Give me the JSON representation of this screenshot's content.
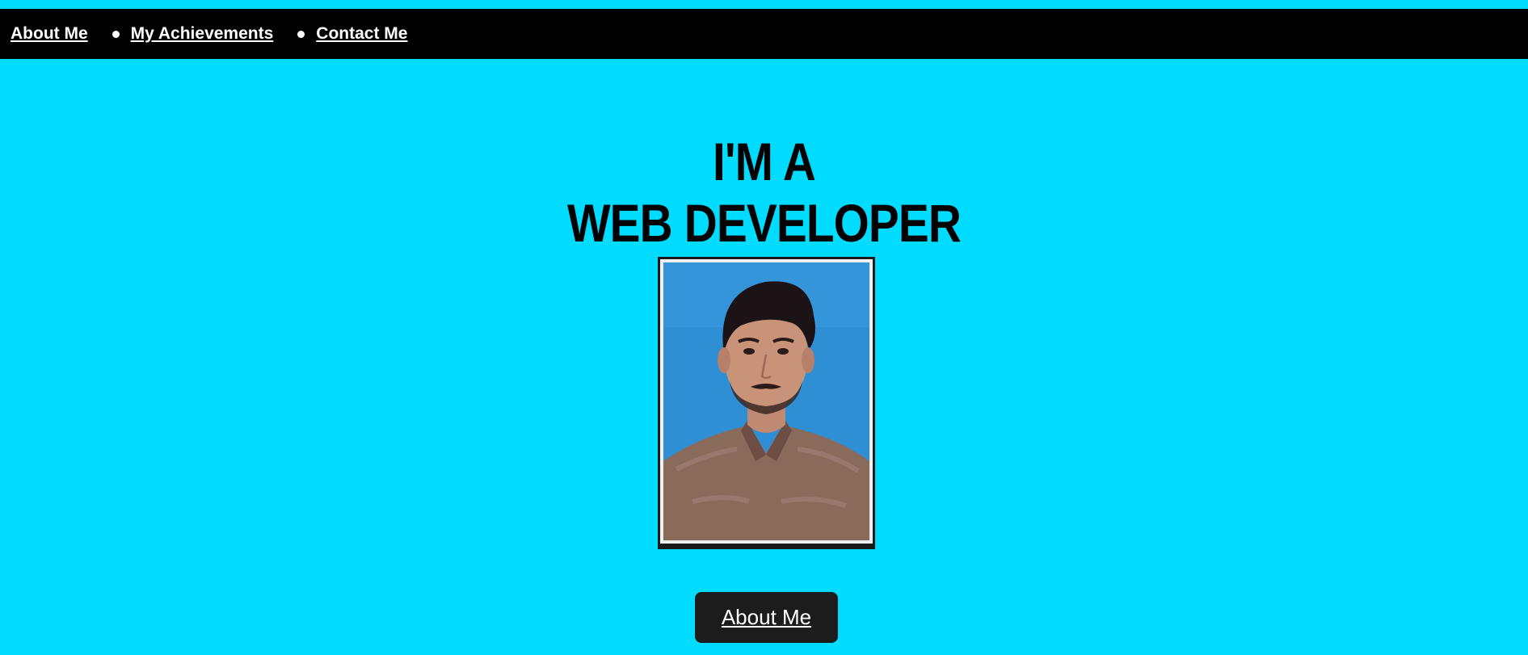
{
  "nav": {
    "items": [
      {
        "label": "About Me"
      },
      {
        "label": "My Achievements"
      },
      {
        "label": "Contact Me"
      }
    ]
  },
  "hero": {
    "line1": "I'M A",
    "line2": "WEB DEVELOPER"
  },
  "photo": {
    "icon": "profile-photo"
  },
  "cta": {
    "label": "About Me"
  },
  "colors": {
    "background": "#00dcff",
    "navbar": "#000000",
    "button": "#1c1c1c",
    "text_light": "#ffffff",
    "text_dark": "#000000"
  }
}
